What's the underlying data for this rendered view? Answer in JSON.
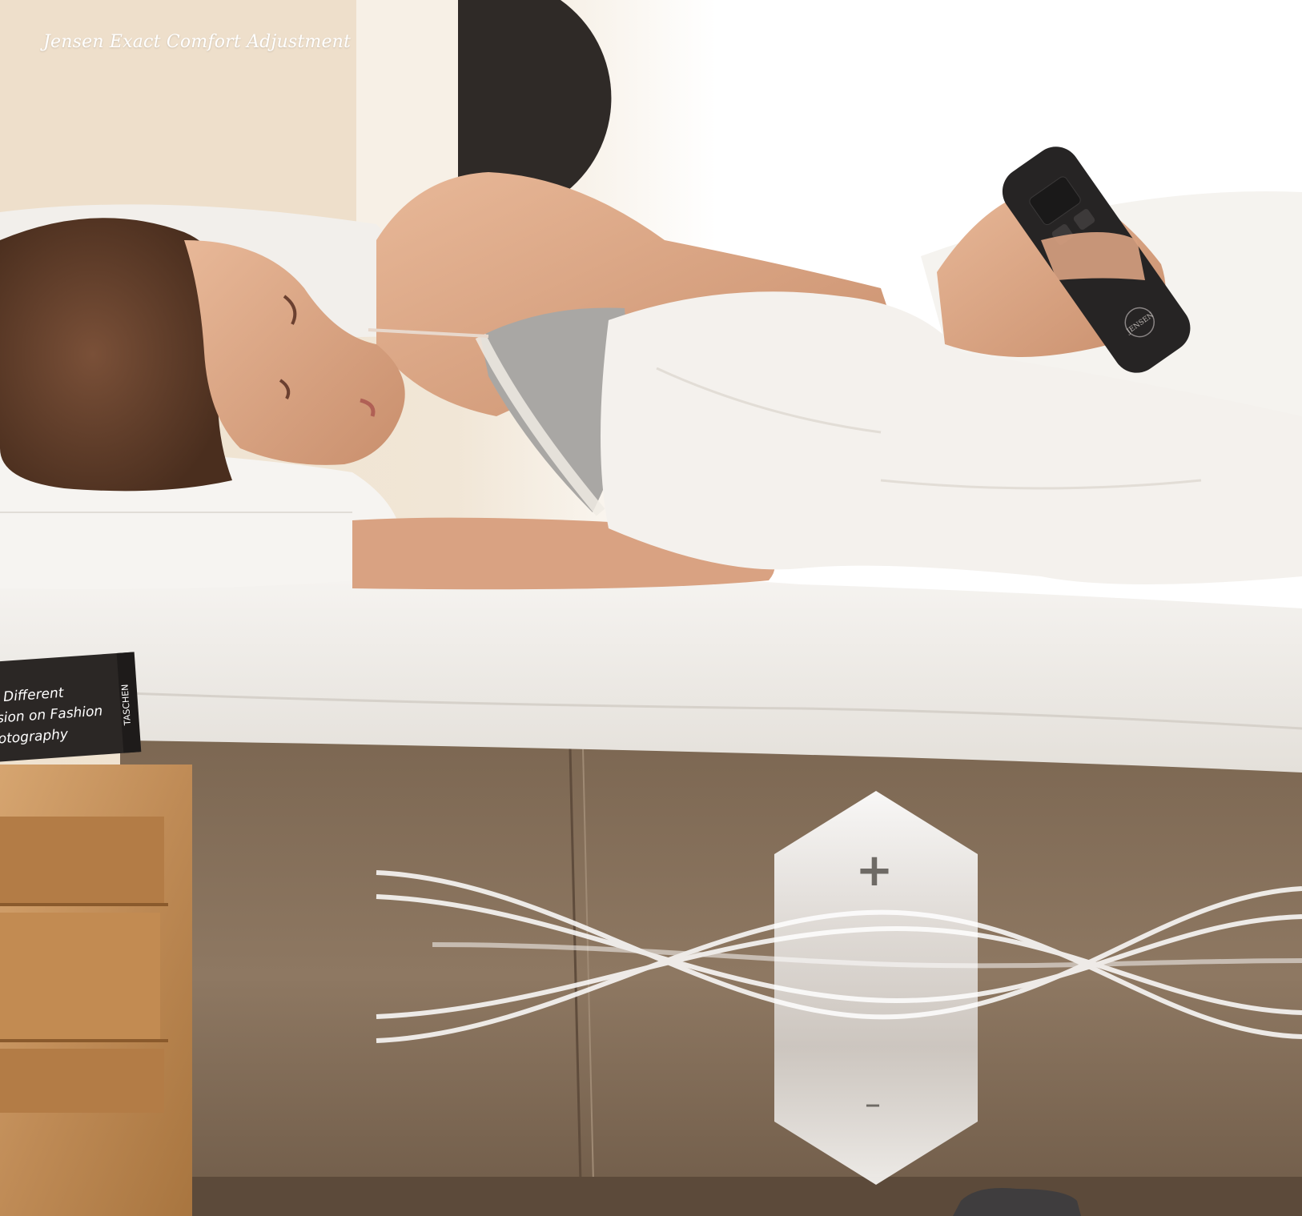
{
  "caption": "Jensen Exact Comfort Adjustment",
  "book": {
    "title_lines": [
      "Different",
      "sion on Fashion",
      "otography"
    ],
    "publisher": "TASCHEN"
  },
  "remote": {
    "brand": "JENSEN"
  },
  "indicator": {
    "plus": "+",
    "minus": "–"
  },
  "colors": {
    "headboard": "#efe3d2",
    "mattress_base": "#8a7560",
    "sheet": "#f1eeea",
    "remote": "#262424",
    "nightstand": "#c89662"
  }
}
